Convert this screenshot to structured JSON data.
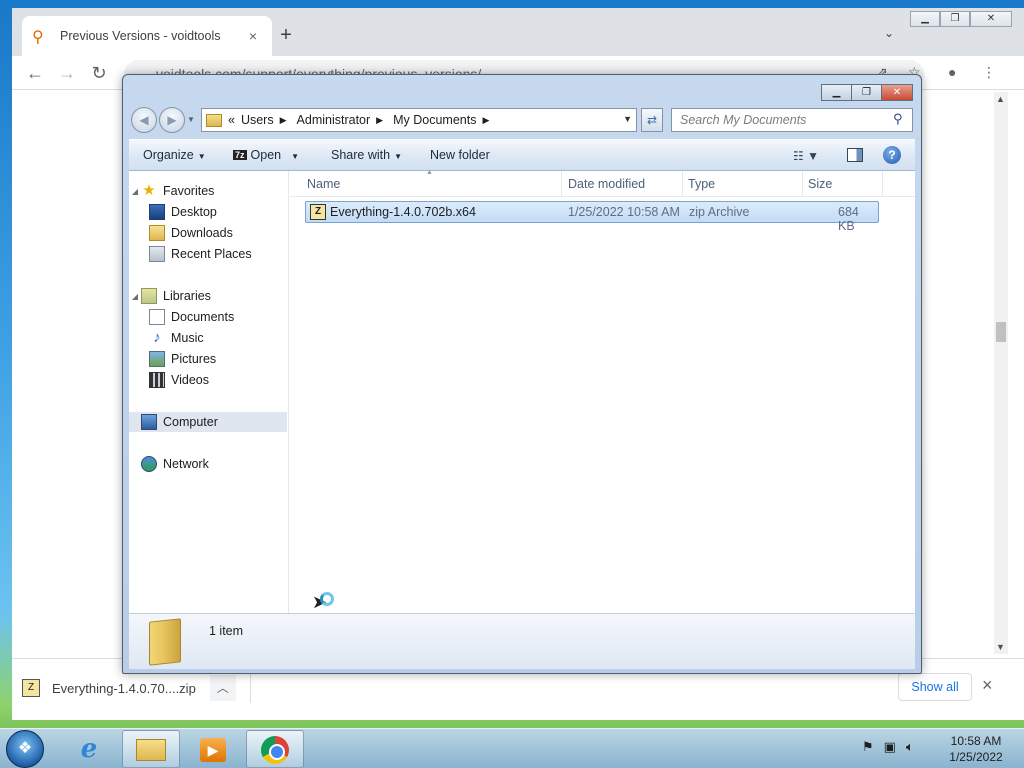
{
  "browser": {
    "tab_title": "Previous Versions - voidtools",
    "tab_close": "×",
    "new_tab": "+",
    "url": "voidtools.com/support/everything/previous_versions/",
    "download": {
      "file_label": "Everything-1.4.0.70....zip",
      "show_all": "Show all",
      "close": "×"
    }
  },
  "explorer": {
    "breadcrumb": [
      "Users",
      "Administrator",
      "My Documents"
    ],
    "breadcrumb_prefix": "«",
    "search_placeholder": "Search My Documents",
    "commands": {
      "organize": "Organize",
      "open": "Open",
      "share_with": "Share with",
      "new_folder": "New folder"
    },
    "nav": {
      "favorites": "Favorites",
      "desktop": "Desktop",
      "downloads": "Downloads",
      "recent_places": "Recent Places",
      "libraries": "Libraries",
      "documents": "Documents",
      "music": "Music",
      "pictures": "Pictures",
      "videos": "Videos",
      "computer": "Computer",
      "network": "Network"
    },
    "columns": {
      "name": "Name",
      "date_modified": "Date modified",
      "type": "Type",
      "size": "Size"
    },
    "files": [
      {
        "name": "Everything-1.4.0.702b.x64",
        "date_modified": "1/25/2022 10:58 AM",
        "type": "zip Archive",
        "size": "684 KB"
      }
    ],
    "status": "1 item"
  },
  "taskbar": {
    "time": "10:58 AM",
    "date": "1/25/2022"
  },
  "icons": {
    "start": "windows-start-orb",
    "ie": "internet-explorer-icon",
    "explorer": "windows-explorer-icon",
    "media_player": "media-player-icon",
    "chrome": "chrome-icon"
  }
}
